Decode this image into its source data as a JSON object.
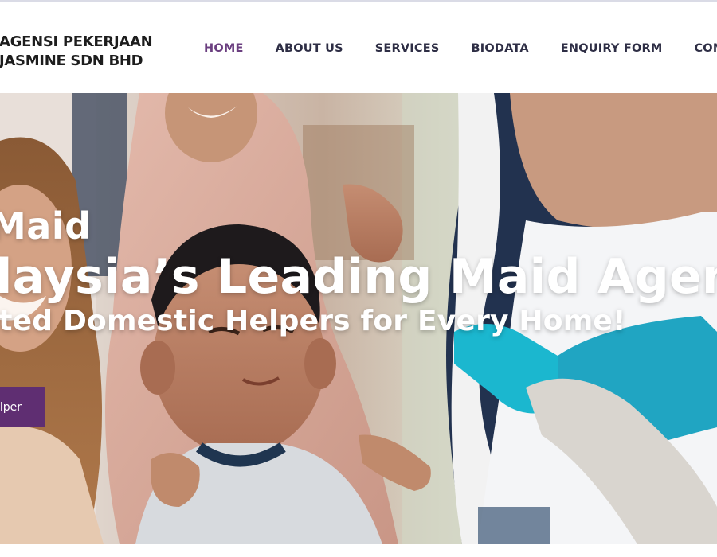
{
  "header": {
    "logo": {
      "line1": "AGENSI PEKERJAAN",
      "line2": "JASMINE SDN BHD"
    },
    "nav": [
      {
        "label": "HOME",
        "active": true
      },
      {
        "label": "ABOUT US"
      },
      {
        "label": "SERVICES"
      },
      {
        "label": "BIODATA"
      },
      {
        "label": "ENQUIRY FORM"
      },
      {
        "label": "CONTACT"
      }
    ],
    "colors": {
      "active": "#6b3f80",
      "text": "#2e2e45"
    }
  },
  "hero": {
    "line1": "Maid",
    "line2": "Malaysia’s Leading Maid Agency –",
    "line3": "Trusted Domestic Helpers for Every Home!",
    "cta_label": "Find a Helper",
    "colors": {
      "cta": "#5f2e72"
    }
  }
}
